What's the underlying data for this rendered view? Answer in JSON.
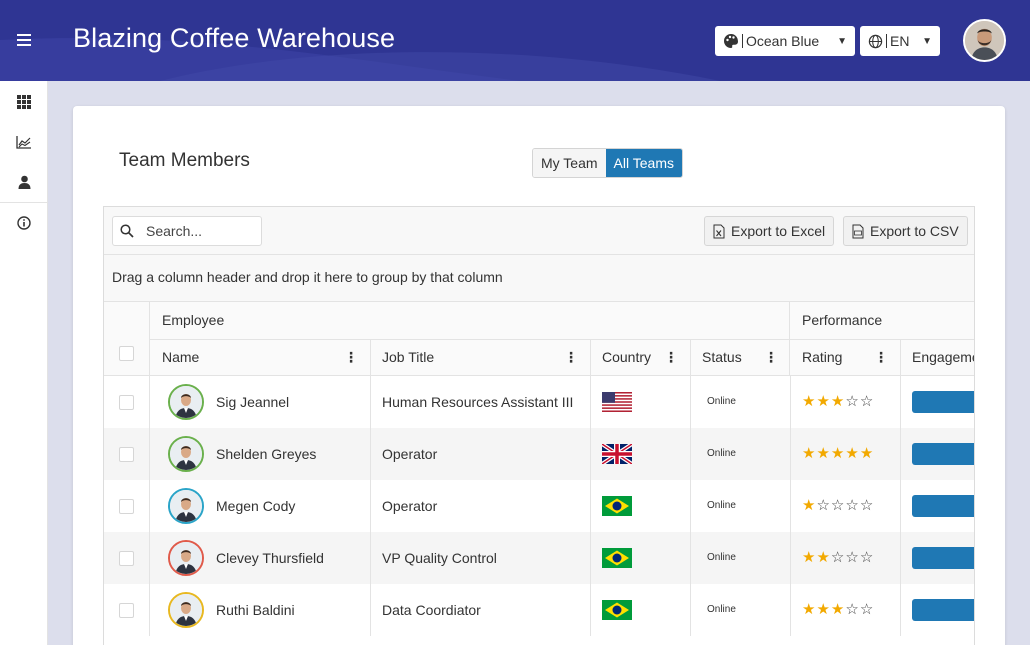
{
  "app": {
    "title": "Blazing Coffee Warehouse"
  },
  "header": {
    "theme_label": "Ocean Blue",
    "lang_label": "EN"
  },
  "sidebar": {
    "items": [
      {
        "name": "apps-grid-icon"
      },
      {
        "name": "chart-icon"
      },
      {
        "name": "user-icon"
      },
      {
        "name": "info-icon"
      }
    ]
  },
  "page": {
    "title": "Team Members",
    "toggle": {
      "my_team": "My Team",
      "all_teams": "All Teams",
      "selected": "All Teams"
    }
  },
  "grid": {
    "search_placeholder": "Search...",
    "export_excel": "Export to Excel",
    "export_csv": "Export to CSV",
    "group_hint": "Drag a column header and drop it here to group by that column",
    "column_groups": {
      "employee": "Employee",
      "performance": "Performance"
    },
    "columns": {
      "name": "Name",
      "job_title": "Job Title",
      "country": "Country",
      "status": "Status",
      "rating": "Rating",
      "engagement": "Engageme"
    },
    "rows": [
      {
        "name": "Sig Jeannel",
        "job_title": "Human Resources Assistant III",
        "country": "us",
        "status": "Online",
        "rating": 3,
        "ring": "#6ab04c"
      },
      {
        "name": "Shelden Greyes",
        "job_title": "Operator",
        "country": "gb",
        "status": "Online",
        "rating": 5,
        "ring": "#6ab04c"
      },
      {
        "name": "Megen Cody",
        "job_title": "Operator",
        "country": "br",
        "status": "Online",
        "rating": 1,
        "ring": "#2aa4c8"
      },
      {
        "name": "Clevey Thursfield",
        "job_title": "VP Quality Control",
        "country": "br",
        "status": "Online",
        "rating": 2,
        "ring": "#e05a4a"
      },
      {
        "name": "Ruthi Baldini",
        "job_title": "Data Coordiator",
        "country": "br",
        "status": "Online",
        "rating": 3,
        "ring": "#e8b820"
      }
    ]
  },
  "colors": {
    "header": "#2f3593",
    "accent": "#1f78b4",
    "star": "#f2a900"
  }
}
